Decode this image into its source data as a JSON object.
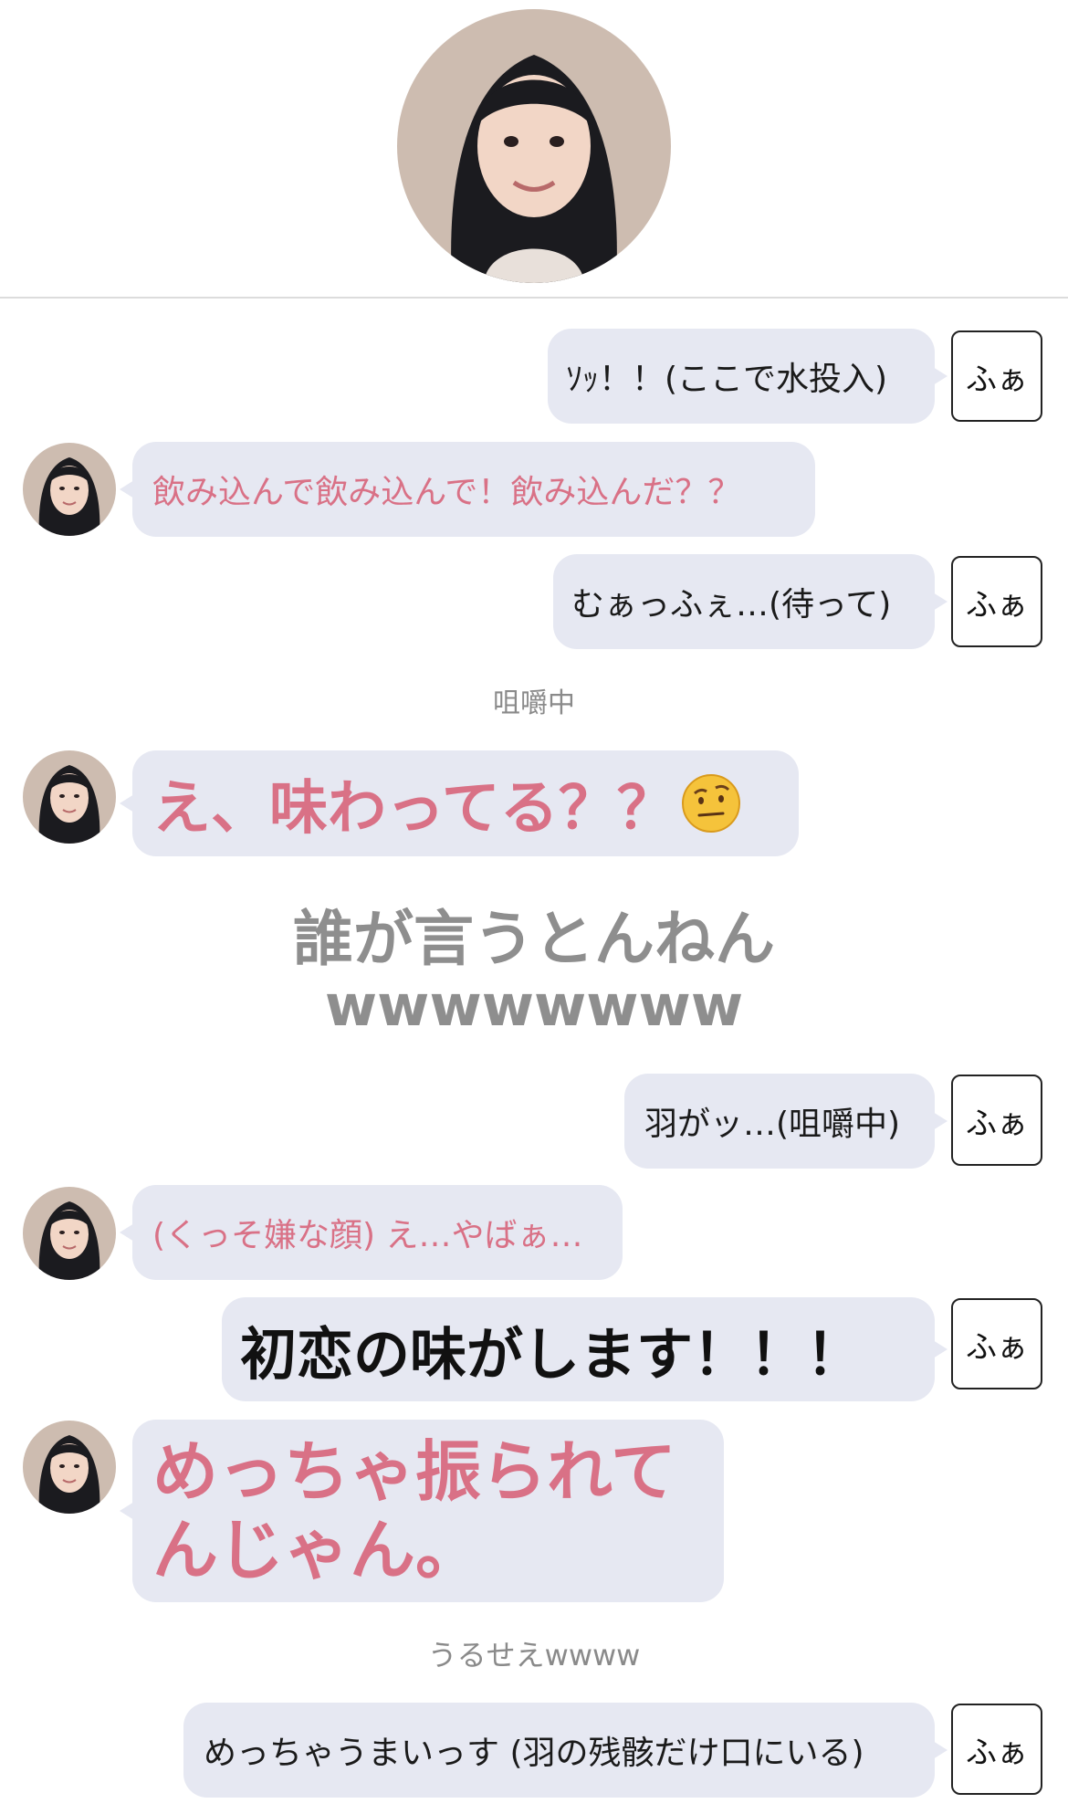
{
  "messages": [
    {
      "side": "right",
      "text": "ｿｯ！！(ここで水投入)",
      "tag": "ふぁ"
    },
    {
      "side": "left",
      "text": "飲み込んで飲み込んで！飲み込んだ？？"
    },
    {
      "side": "right",
      "text": "むぁっふぇ…(待って)",
      "tag": "ふぁ"
    },
    {
      "type": "narration",
      "text": "咀嚼中"
    },
    {
      "side": "left",
      "text": "え、味わってる？？",
      "emoji": "🤨"
    },
    {
      "type": "narration",
      "text_line1": "誰が言うとんねん",
      "text_line2": "wwwwwwww"
    },
    {
      "side": "right",
      "text": "羽がッ…(咀嚼中)",
      "tag": "ふぁ"
    },
    {
      "side": "left",
      "text": "(くっそ嫌な顔) え…やばぁ…"
    },
    {
      "side": "right",
      "text": "初恋の味がします！！！",
      "tag": "ふぁ"
    },
    {
      "side": "left",
      "text_line1": "めっちゃ振られて",
      "text_line2": "んじゃん。"
    },
    {
      "type": "narration",
      "text": "うるせえwwww"
    },
    {
      "side": "right",
      "text": "めっちゃうまいっす (羽の残骸だけ口にいる)",
      "tag": "ふぁ"
    }
  ],
  "colors": {
    "bubble": "#e6e8f2",
    "pink_text": "#d97186",
    "narration": "#8a8a8a"
  }
}
